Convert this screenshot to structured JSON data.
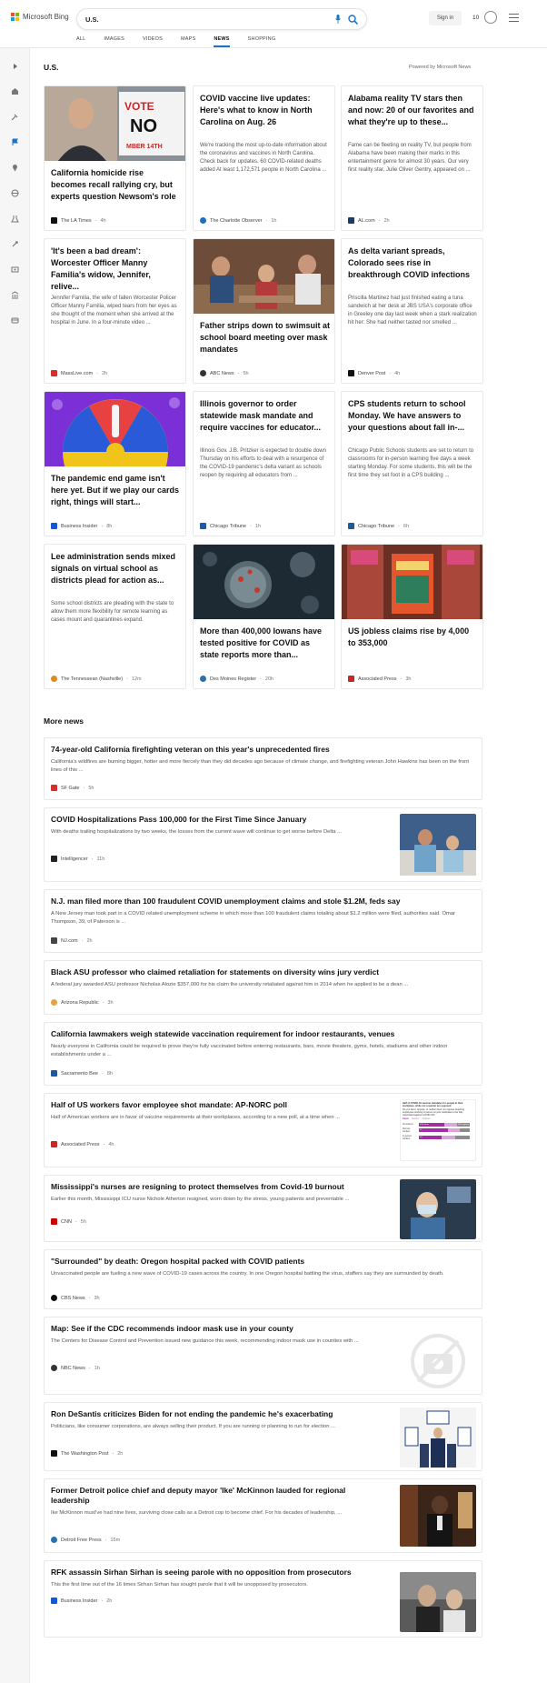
{
  "header": {
    "brand": "Microsoft Bing",
    "brand_colors": [
      "#f25022",
      "#7fba00",
      "#00a4ef",
      "#ffb900"
    ],
    "search_value": "U.S.",
    "sign_in": "Sign in",
    "rewards_count": "10",
    "tabs": [
      {
        "label": "ALL"
      },
      {
        "label": "IMAGES"
      },
      {
        "label": "VIDEOS"
      },
      {
        "label": "MAPS"
      },
      {
        "label": "NEWS"
      },
      {
        "label": "SHOPPING"
      }
    ],
    "active_tab": "NEWS"
  },
  "rail_icons": [
    "expand-icon",
    "home-icon",
    "tools-icon",
    "flag-icon",
    "location-icon",
    "globe-icon",
    "science-icon",
    "rocket-icon",
    "entertainment-icon",
    "money-icon",
    "sports-icon"
  ],
  "main": {
    "title": "U.S.",
    "powered_by": "Powered by Microsoft News",
    "cards": [
      {
        "title": "California homicide rise becomes recall rallying cry, but experts question Newsom's role",
        "snippet": "",
        "source": "The LA Times",
        "ago": "4h",
        "src_color": "#111111"
      },
      {
        "title": "COVID vaccine live updates: Here's what to know in North Carolina on Aug. 26",
        "snippet": "We're tracking the most up-to-date information about the coronavirus and vaccines in North Carolina. Check back for updates. 60 COVID-related deaths added At least 1,172,571 people in North Carolina ...",
        "source": "The Charlotte Observer",
        "ago": "1h",
        "src_color": "#1f6fbf"
      },
      {
        "title": "Alabama reality TV stars then and now: 20 of our favorites and what they're up to these...",
        "snippet": "Fame can be fleeting on reality TV, but people from Alabama have been making their marks in this entertainment genre for almost 30 years. Our very first reality star, Julie Oliver Gentry, appeared on ...",
        "source": "AL.com",
        "ago": "2h",
        "src_color": "#1a3a6b"
      },
      {
        "title": "'It's been a bad dream': Worcester Officer Manny Familia's widow, Jennifer, relive...",
        "snippet": "Jennifer Familia, the wife of fallen Worcester Policer Officer Manny Familia, wiped tears from her eyes as she thought of the moment when she arrived at the hospital in June. In a four-minute video ...",
        "source": "MassLive.com",
        "ago": "2h",
        "src_color": "#d32f2f"
      },
      {
        "title": "Father strips down to swimsuit at school board meeting over mask mandates",
        "snippet": "",
        "source": "ABC News",
        "ago": "5h",
        "src_color": "#333333"
      },
      {
        "title": "As delta variant spreads, Colorado sees rise in breakthrough COVID infections",
        "snippet": "Priscilla Martinez had just finished eating a tuna sandwich at her desk at JBS USA's corporate office in Greeley one day last week when a stark realization hit her: She had neither tasted nor smelled ...",
        "source": "Denver Post",
        "ago": "4h",
        "src_color": "#111111"
      },
      {
        "title": "The pandemic end game isn't here yet. But if we play our cards right, things will start...",
        "snippet": "",
        "source": "Business Insider",
        "ago": "8h",
        "src_color": "#1558d6"
      },
      {
        "title": "Illinois governor to order statewide mask mandate and require vaccines for educator...",
        "snippet": "Illinois Gov. J.B. Pritzker is expected to double down Thursday on his efforts to deal with a resurgence of the COVID-19 pandemic's delta variant as schools reopen by requiring all educators from ...",
        "source": "Chicago Tribune",
        "ago": "1h",
        "src_color": "#1f5a9c"
      },
      {
        "title": "CPS students return to school Monday. We have answers to your questions about fall in-...",
        "snippet": "Chicago Public Schools students are set to return to classrooms for in-person learning five days a week starting Monday. For some students, this will be the first time they set foot in a CPS building ...",
        "source": "Chicago Tribune",
        "ago": "6h",
        "src_color": "#1f5a9c"
      },
      {
        "title": "Lee administration sends mixed signals on virtual school as districts plead for action as...",
        "snippet": "Some school districts are pleading with the state to allow them more flexibility for remote learning as cases mount and quarantines expand.",
        "source": "The Tennessean (Nashville)",
        "ago": "12m",
        "src_color": "#e08a1e"
      },
      {
        "title": "More than 400,000 Iowans have tested positive for COVID as state reports more than...",
        "snippet": "",
        "source": "Des Moines Register",
        "ago": "20h",
        "src_color": "#2a6fb0"
      },
      {
        "title": "US jobless claims rise by 4,000 to 353,000",
        "snippet": "",
        "source": "Associated Press",
        "ago": "3h",
        "src_color": "#c62828"
      }
    ],
    "more_news_title": "More news",
    "more_news": [
      {
        "title": "74-year-old California firefighting veteran on this year's unprecedented fires",
        "snippet": "California's wildfires are burning bigger, hotter and more fiercely than they did decades ago because of climate change, and firefighting veteran John Hawkins has been on the front lines of this ...",
        "source": "SF Gate",
        "ago": "5h",
        "src_color": "#d32f2f"
      },
      {
        "title": "COVID Hospitalizations Pass 100,000 for the First Time Since January",
        "snippet": "With deaths trailing hospitalizations by two weeks, the losses from the current wave will continue to get worse before Delta ...",
        "source": "Intelligencer",
        "ago": "11h",
        "src_color": "#222222"
      },
      {
        "title": "N.J. man filed more than 100 fraudulent COVID unemployment claims and stole $1.2M, feds say",
        "snippet": "A New Jersey man took part in a COVID related unemployment scheme in which more than 100 fraudulent claims totaling about $1.2 million were filed, authorities said. Omar Thompson, 39, of Paterson is ...",
        "source": "NJ.com",
        "ago": "2h",
        "src_color": "#444444"
      },
      {
        "title": "Black ASU professor who claimed retaliation for statements on diversity wins jury verdict",
        "snippet": "A federal jury awarded ASU professor Nicholas Alozie $357,000 for his claim the university retaliated against him in 2014 when he applied to be a dean ...",
        "source": "Arizona Republic",
        "ago": "3h",
        "src_color": "#e6a23c"
      },
      {
        "title": "California lawmakers weigh statewide vaccination requirement for indoor restaurants, venues",
        "snippet": "Nearly everyone in California could be required to prove they're fully vaccinated before entering restaurants, bars, movie theaters, gyms, hotels, stadiums and other indoor establishments under a ...",
        "source": "Sacramento Bee",
        "ago": "8h",
        "src_color": "#1f5a9c"
      },
      {
        "title": "Half of US workers favor employee shot mandate: AP-NORC poll",
        "snippet": "Half of American workers are in favor of vaccine requirements at their workplaces, according to a new poll, at a time when ...",
        "source": "Associated Press",
        "ago": "4h",
        "src_color": "#c62828"
      },
      {
        "title": "Mississippi's nurses are resigning to protect themselves from Covid-19 burnout",
        "snippet": "Earlier this month, Mississippi ICU nurse Nichole Atherton resigned, worn down by the stress, young patients and preventable ...",
        "source": "CNN",
        "ago": "5h",
        "src_color": "#cc0000"
      },
      {
        "title": "\"Surrounded\" by death: Oregon hospital packed with COVID patients",
        "snippet": "Unvaccinated people are fueling a new wave of COVID-19 cases across the country. In one Oregon hospital battling the virus, staffers say they are surrounded by death.",
        "source": "CBS News",
        "ago": "3h",
        "src_color": "#111111"
      },
      {
        "title": "Map: See if the CDC recommends indoor mask use in your county",
        "snippet": "The Centers for Disease Control and Prevention issued new guidance this week, recommending indoor mask use in counties with ...",
        "source": "NBC News",
        "ago": "1h",
        "src_color": "#333333"
      },
      {
        "title": "Ron DeSantis criticizes Biden for not ending the pandemic he's exacerbating",
        "snippet": "Politicians, like consumer corporations, are always selling their product. If you are running or planning to run for election ...",
        "source": "The Washington Post",
        "ago": "2h",
        "src_color": "#111111"
      },
      {
        "title": "Former Detroit police chief and deputy mayor 'Ike' McKinnon lauded for regional leadership",
        "snippet": "Ike McKinnon must've had nine lives, surviving close calls as a Detroit cop to become chief. For his decades of leadership, ...",
        "source": "Detroit Free Press",
        "ago": "15m",
        "src_color": "#2a6fb0"
      },
      {
        "title": "RFK assassin Sirhan Sirhan is seeing parole with no opposition from prosecutors",
        "snippet": "This the first time out of the 16 times Sirhan Sirhan has sought parole that it will be unopposed by prosecutors.",
        "source": "Business Insider",
        "ago": "2h",
        "src_color": "#1558d6"
      }
    ],
    "poll_chart": {
      "heading": "Half of COVID-19 vaccine mandates for people at their workplace, while not a quarter are opposed",
      "question": "Do you favor, oppose, or neither favor nor oppose requiring employees working in person at your workplace to be fully vaccinated against COVID-19?",
      "legend": [
        "Favor",
        "Neither",
        "Oppose"
      ],
      "rows": [
        {
          "label": "All workers",
          "favor": "50% favor",
          "other": "25% oppose",
          "favor_value": 50,
          "neither_value": 25,
          "oppose_value": 25
        },
        {
          "label": "Remote workers",
          "favor": "57",
          "other": "",
          "favor_value": 57,
          "neither_value": 23,
          "oppose_value": 20
        },
        {
          "label": "In-person workers",
          "favor": "45",
          "other": "",
          "favor_value": 45,
          "neither_value": 26,
          "oppose_value": 29
        }
      ],
      "colors": {
        "favor": "#a32da3",
        "neither": "#d9a6d9",
        "oppose": "#8c8c8c"
      }
    }
  }
}
